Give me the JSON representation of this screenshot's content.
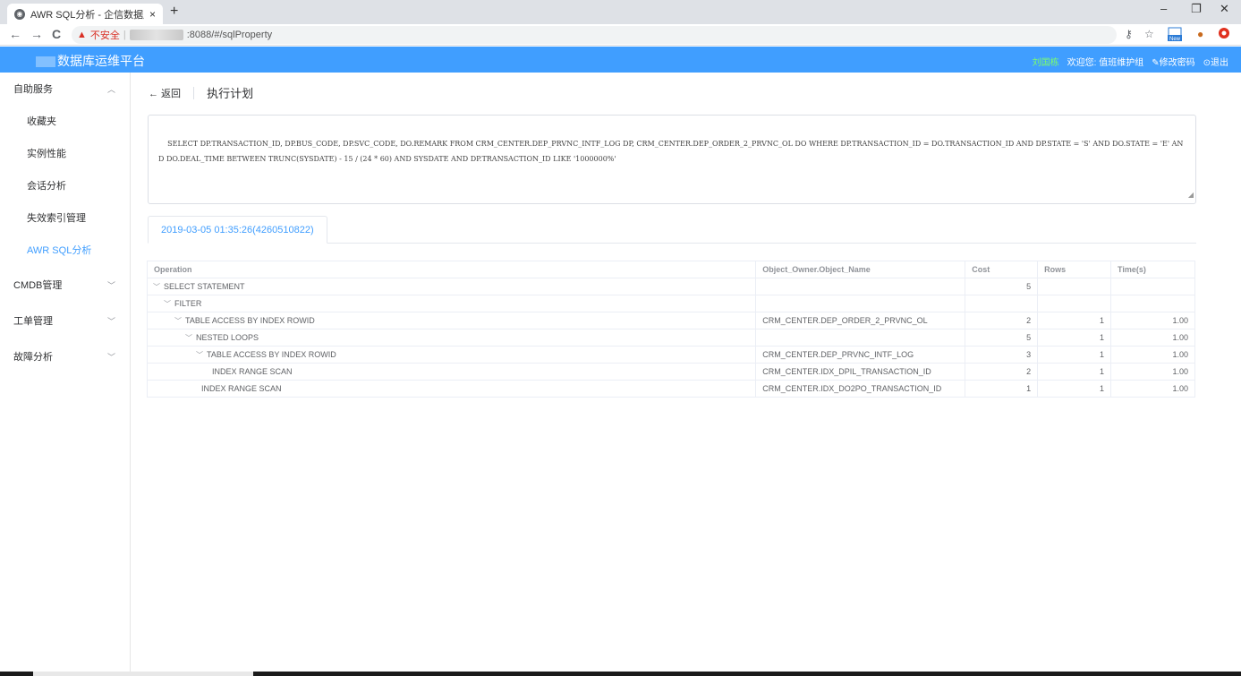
{
  "browser": {
    "tab_title": "AWR SQL分析 - 企信数据库运维",
    "tab_close": "×",
    "new_tab": "+",
    "minimize": "–",
    "restore": "❐",
    "close_window": "✕",
    "back": "←",
    "forward": "→",
    "reload": "C",
    "insecure_label": "不安全",
    "address_separator": "|",
    "url_tail": ":8088/#/sqlProperty"
  },
  "header": {
    "brand": "数据库运维平台",
    "user": "刘国栋",
    "welcome": "欢迎您: 值班维护组",
    "change_password": "修改密码",
    "logout": "退出",
    "color": "#409eff"
  },
  "sidebar": {
    "groups": [
      {
        "label": "自助服务",
        "expanded": true
      },
      {
        "label": "CMDB管理",
        "expanded": false
      },
      {
        "label": "工单管理",
        "expanded": false
      },
      {
        "label": "故障分析",
        "expanded": false
      }
    ],
    "items": [
      {
        "label": "收藏夹"
      },
      {
        "label": "实例性能"
      },
      {
        "label": "会话分析"
      },
      {
        "label": "失效索引管理"
      },
      {
        "label": "AWR SQL分析",
        "active": true
      }
    ]
  },
  "main": {
    "back_label": "← 返回",
    "page_title": "执行计划",
    "sql_text": "SELECT DP.TRANSACTION_ID, DP.BUS_CODE, DP.SVC_CODE, DO.REMARK FROM CRM_CENTER.DEP_PRVNC_INTF_LOG DP, CRM_CENTER.DEP_ORDER_2_PRVNC_OL DO WHERE DP.TRANSACTION_ID = DO.TRANSACTION_ID AND DP.STATE = 'S' AND DO.STATE = 'E' AND DO.DEAL_TIME BETWEEN TRUNC(SYSDATE) - 15 / (24 * 60) AND SYSDATE AND DP.TRANSACTION_ID LIKE '1000000%'",
    "tab_label": "2019-03-05 01:35:26(4260510822)",
    "table": {
      "columns": [
        "Operation",
        "Object_Owner.Object_Name",
        "Cost",
        "Rows",
        "Time(s)"
      ],
      "rows": [
        {
          "op": "SELECT STATEMENT",
          "toggle": true,
          "obj": "",
          "cost": "5",
          "rows": "",
          "time": ""
        },
        {
          "op": "FILTER",
          "toggle": true,
          "obj": "",
          "cost": "",
          "rows": "",
          "time": ""
        },
        {
          "op": "TABLE ACCESS BY INDEX ROWID",
          "toggle": true,
          "obj": "CRM_CENTER.DEP_ORDER_2_PRVNC_OL",
          "cost": "2",
          "rows": "1",
          "time": "1.00"
        },
        {
          "op": "NESTED LOOPS",
          "toggle": true,
          "obj": "",
          "cost": "5",
          "rows": "1",
          "time": "1.00"
        },
        {
          "op": "TABLE ACCESS BY INDEX ROWID",
          "toggle": true,
          "obj": "CRM_CENTER.DEP_PRVNC_INTF_LOG",
          "cost": "3",
          "rows": "1",
          "time": "1.00"
        },
        {
          "op": "INDEX RANGE SCAN",
          "toggle": false,
          "obj": "CRM_CENTER.IDX_DPIL_TRANSACTION_ID",
          "cost": "2",
          "rows": "1",
          "time": "1.00"
        },
        {
          "op": "INDEX RANGE SCAN",
          "toggle": false,
          "obj": "CRM_CENTER.IDX_DO2PO_TRANSACTION_ID",
          "cost": "1",
          "rows": "1",
          "time": "1.00"
        }
      ]
    }
  }
}
